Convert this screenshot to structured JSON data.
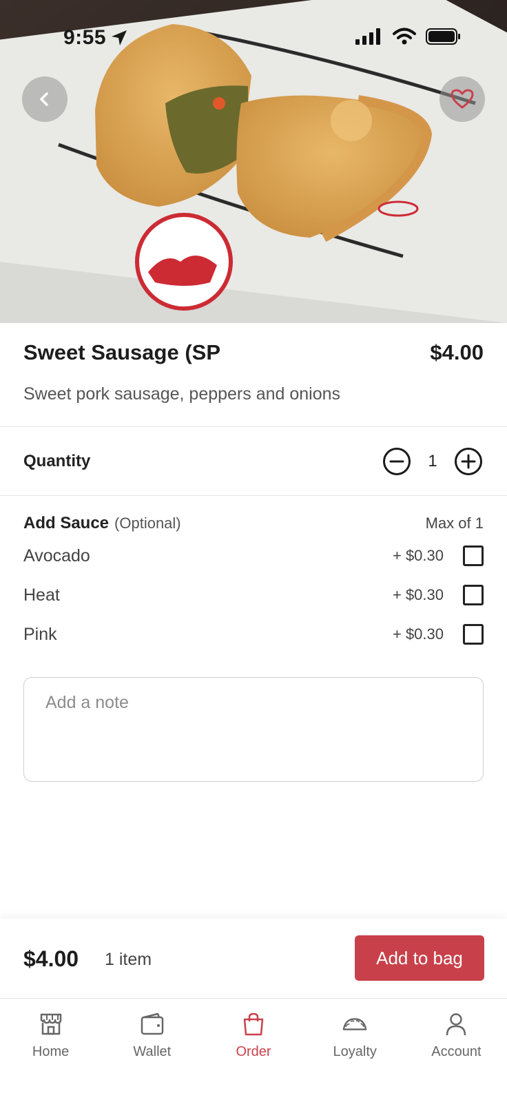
{
  "status_bar": {
    "time": "9:55"
  },
  "item": {
    "title": "Sweet Sausage (SP",
    "price": "$4.00",
    "description": "Sweet pork sausage, peppers and onions"
  },
  "quantity": {
    "label": "Quantity",
    "value": "1"
  },
  "sauce": {
    "title": "Add Sauce",
    "optional": "(Optional)",
    "max": "Max of 1",
    "options": [
      {
        "name": "Avocado",
        "price": "+ $0.30"
      },
      {
        "name": "Heat",
        "price": "+ $0.30"
      },
      {
        "name": "Pink",
        "price": "+ $0.30"
      }
    ]
  },
  "note": {
    "placeholder": "Add a note"
  },
  "bag": {
    "total": "$4.00",
    "count": "1 item",
    "add_label": "Add to bag"
  },
  "tabs": [
    {
      "label": "Home",
      "icon": "store-icon"
    },
    {
      "label": "Wallet",
      "icon": "wallet-icon"
    },
    {
      "label": "Order",
      "icon": "bag-icon",
      "active": true
    },
    {
      "label": "Loyalty",
      "icon": "empanada-icon"
    },
    {
      "label": "Account",
      "icon": "person-icon"
    }
  ],
  "colors": {
    "accent": "#c8414a",
    "text": "#222222",
    "muted": "#555555"
  }
}
